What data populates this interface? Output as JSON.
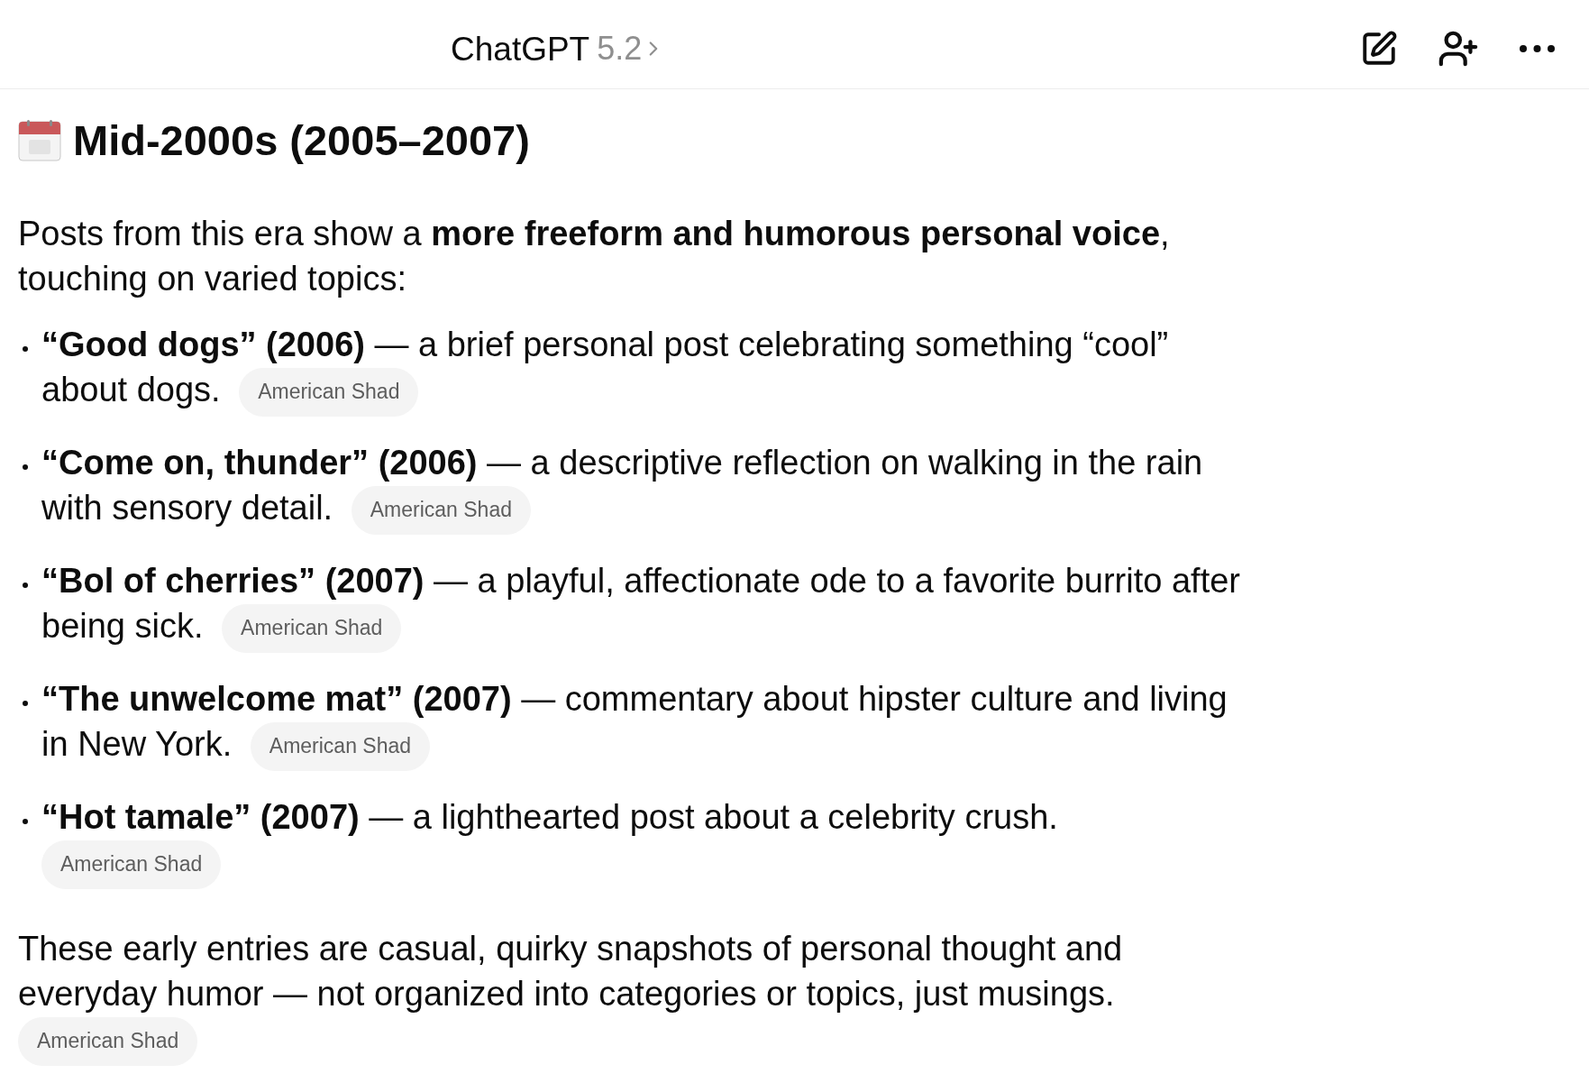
{
  "header": {
    "title": "ChatGPT",
    "model_version": "5.2"
  },
  "heading": "Mid-2000s (2005–2007)",
  "intro": "Posts from this era show a **more freeform and humorous personal voice**, touching on varied topics:",
  "items": [
    {
      "text": "**“Good dogs” (2006)** — a brief personal post celebrating something “cool” about dogs.",
      "source": "American Shad"
    },
    {
      "text": "**“Come on, thunder” (2006)** — a descriptive reflection on walking in the rain with sensory detail.",
      "source": "American Shad"
    },
    {
      "text": "**“Bol of cherries” (2007)** — a playful, affectionate ode to a favorite burrito after being sick.",
      "source": "American Shad"
    },
    {
      "text": "**“The unwelcome mat” (2007)** — commentary about hipster culture and living in New York.",
      "source": "American Shad"
    },
    {
      "text": "**“Hot tamale” (2007)** — a lighthearted post about a celebrity crush.",
      "source": "American Shad"
    }
  ],
  "summary": {
    "text": "These early entries are casual, quirky snapshots of personal thought and everyday humor — not organized into categories or topics, just musings.",
    "source": "American Shad"
  }
}
